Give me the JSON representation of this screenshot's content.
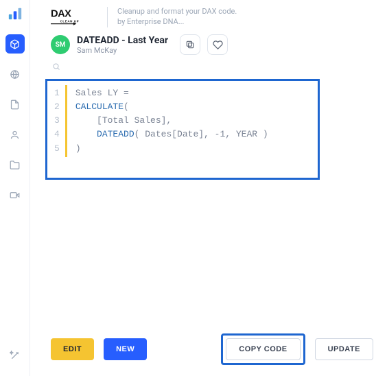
{
  "brand": {
    "name": "DAX",
    "sub": "CLEAN UP"
  },
  "tagline": {
    "line1": "Cleanup and format your DAX code.",
    "line2": "by Enterprise DNA..."
  },
  "sidebar": {
    "items": [
      {
        "name": "box-icon",
        "active": true
      },
      {
        "name": "globe-icon"
      },
      {
        "name": "file-icon"
      },
      {
        "name": "user-icon"
      },
      {
        "name": "folder-icon"
      },
      {
        "name": "video-icon"
      }
    ],
    "footer_icon": "wand-icon"
  },
  "title": {
    "heading": "DATEADD - Last Year",
    "author": "Sam McKay",
    "avatar": "SM"
  },
  "actions": {
    "duplicate_tooltip": "Duplicate",
    "favorite_tooltip": "Favorite"
  },
  "code": {
    "line_numbers": [
      "1",
      "2",
      "3",
      "4",
      "5"
    ],
    "lines": [
      [
        {
          "t": "Sales LY =",
          "c": "tok-plain"
        }
      ],
      [
        {
          "t": "CALCULATE",
          "c": "tok-fn"
        },
        {
          "t": "(",
          "c": "tok-plain"
        }
      ],
      [
        {
          "t": "    [Total Sales],",
          "c": "tok-col"
        }
      ],
      [
        {
          "t": "    ",
          "c": "tok-plain"
        },
        {
          "t": "DATEADD",
          "c": "tok-fn"
        },
        {
          "t": "( Dates[Date], -1, YEAR )",
          "c": "tok-col"
        }
      ],
      [
        {
          "t": ")",
          "c": "tok-plain"
        }
      ]
    ]
  },
  "footer": {
    "edit": "EDIT",
    "new": "NEW",
    "copy": "COPY CODE",
    "update": "UPDATE"
  }
}
